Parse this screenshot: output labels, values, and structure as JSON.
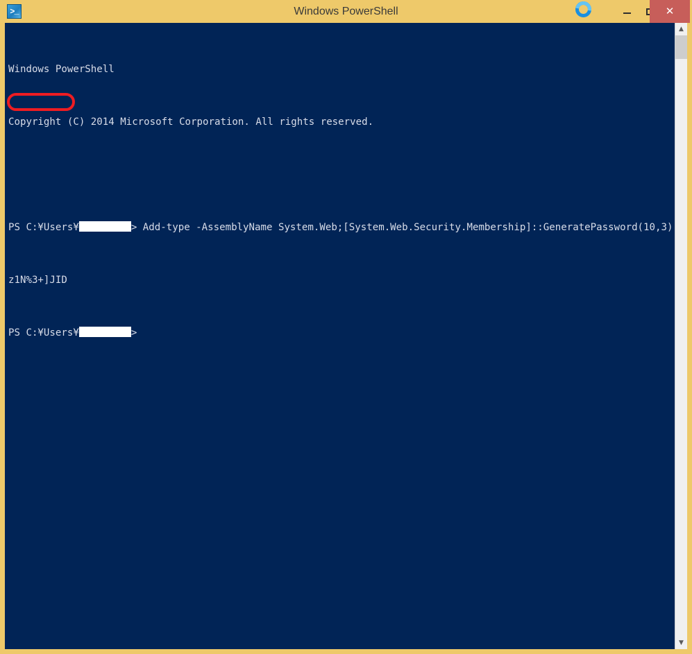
{
  "window": {
    "title": "Windows PowerShell",
    "app_icon": "powershell-icon",
    "icon_glyph": ">_",
    "frame_color": "#eec96a",
    "console_bg": "#012456",
    "console_fg": "#d8dce8"
  },
  "titlebar": {
    "busy_indicator": "busy-ring-icon",
    "busy_color": "#1a8fe0",
    "controls": {
      "minimize_label": "—",
      "maximize_label": "□",
      "close_label": "✕",
      "close_bg": "#c75e5a"
    }
  },
  "console": {
    "lines": [
      {
        "id": "banner-title",
        "text": "Windows PowerShell"
      },
      {
        "id": "banner-copyright",
        "text": "Copyright (C) 2014 Microsoft Corporation. All rights reserved."
      },
      {
        "id": "blank-1",
        "text": ""
      },
      {
        "id": "prompt-1-prefix",
        "text": "PS C:¥Users¥"
      },
      {
        "id": "prompt-1-suffix",
        "text": "> Add-type -AssemblyName System.Web;[System.Web.Security.Membership]::GeneratePassword(10,3)"
      },
      {
        "id": "output-password",
        "text": "z1N%3+]JID"
      },
      {
        "id": "prompt-2-prefix",
        "text": "PS C:¥Users¥"
      },
      {
        "id": "prompt-2-suffix",
        "text": ">"
      }
    ],
    "redaction_label": "redacted-username"
  },
  "annotation": {
    "shape": "oval-highlight",
    "color": "#ee1c22",
    "target_text": "z1N%3+]JID"
  },
  "scrollbar": {
    "up_arrow": "▲",
    "down_arrow": "▼",
    "thumb_label": "scrollbar-thumb"
  }
}
